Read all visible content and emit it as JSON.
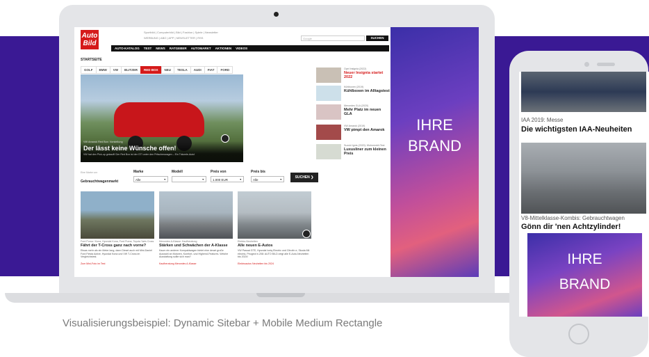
{
  "caption": "Visualisierungsbeispiel: Dynamic Sitebar + Mobile Medium Rectangle",
  "colors": {
    "band": "#3a1994",
    "accent": "#d51a1a"
  },
  "site": {
    "logo_line1": "Auto",
    "logo_line2": "Bild",
    "startseite": "STARTSEITE",
    "top_links": "Sportbild | Computerbild | Bild | Fashion | Spiele | Newsletter",
    "top_links2": "WERBUNG | ABO | APP | NEWSLETTER | RSS",
    "search_label": "Google",
    "search_button": "SUCHEN",
    "nav": [
      "AUTO-KATALOG",
      "TEST",
      "NEWS",
      "RATGEBER",
      "AUTOMARKT",
      "AKTIONEN",
      "VIDEOS"
    ],
    "brand_tabs": [
      "GOLF",
      "BMW",
      "VW",
      "BLITZER",
      "RED BOX",
      "NEU",
      "TESLA",
      "AUDI",
      "FIAT",
      "FORD"
    ],
    "active_tab_index": 4,
    "hero": {
      "kicker": "VW Amarok Red Box: Vorstellung",
      "title": "Der lässt keine Wünsche offen!",
      "subtitle": "VW hat den Pick-up gekauft! Der Red Box ist der GTI unter den Pritschenwagen – Ein Träumle-Auto!"
    },
    "side_items": [
      {
        "kicker": "Opel Insignia (2022)",
        "title": "Neuer Insignia startet 2022",
        "red": true
      },
      {
        "kicker": "Kühlboxen (2019)",
        "title": "Kühlboxen im Alltagstest",
        "red": false
      },
      {
        "kicker": "Mercedes GLA (2020)",
        "title": "Mehr Platz im neuen GLA",
        "red": false
      },
      {
        "kicker": "VW Amarok (2019)",
        "title": "VW pimpt den Amarok",
        "red": false
      },
      {
        "kicker": "Suzuki Ignis (2020): Wohnmobil-Test",
        "title": "Luxusliner zum kleinen Preis",
        "red": false
      }
    ],
    "filter": {
      "badge": "Eine Marke von",
      "label": "Gebrauchtwagenmarkt",
      "marke_label": "Marke",
      "marke_value": "Alle",
      "modell_label": "Modell",
      "modell_value": "",
      "preis_von_label": "Preis von",
      "preis_von_value": "1.000 EUR",
      "preis_bis_label": "Preis bis",
      "preis_bis_value": "Alle",
      "button": "SUCHEN"
    },
    "teasers": [
      {
        "kicker": "Ford Puma / Kona, Hyundai Kona, Ford Puma, Toyota Yaris Cross",
        "title": "Fährt der T-Cross ganz nach vorne?",
        "text": "Etwas mehr als ein Meter lang, dann Diesel auch mit Mini-Daniel Ford Fiesta Active, Hyundai Kona und VW T-Cross im Vergleichstest.",
        "link": "Zum Mini-Foto im Test"
      },
      {
        "kicker": "Mercedes A-Klasse: Kaufberatung",
        "title": "Stärken und Schwächen der A-Klasse",
        "text": "Kaum ein anderer Kompaktwagen bietet eine derart große Auswahl an Motoren, Komfort- und Highend-Features. Welche Ausstattung sollte sich man?",
        "link": "Kaufberatung Mercedes A-Klasse"
      },
      {
        "kicker": "Elektro-Neuheiten",
        "title": "Alle neuen E-Autos",
        "text": "VW Passat GTE, Hyundai Ioniq Electric und Citroën e, Skoda Mii electric, Peugeot e-208: AUTO BILD zeigt alle E-Auto-Neuheiten bis 2024!",
        "link": "Elektroautos Neuheiten bis 2024"
      }
    ]
  },
  "ad_laptop": {
    "line1": "IHRE",
    "line2": "BRAND"
  },
  "phone": {
    "item1_kicker": "IAA 2019: Messe",
    "item1_title": "Die wichtigsten IAA-Neuheiten",
    "item2_kicker": "V8-Mittelklasse-Kombis: Gebrauchtwagen",
    "item2_title": "Gönn dir 'nen Achtzylinder!",
    "ad_line1": "IHRE",
    "ad_line2": "BRAND"
  }
}
